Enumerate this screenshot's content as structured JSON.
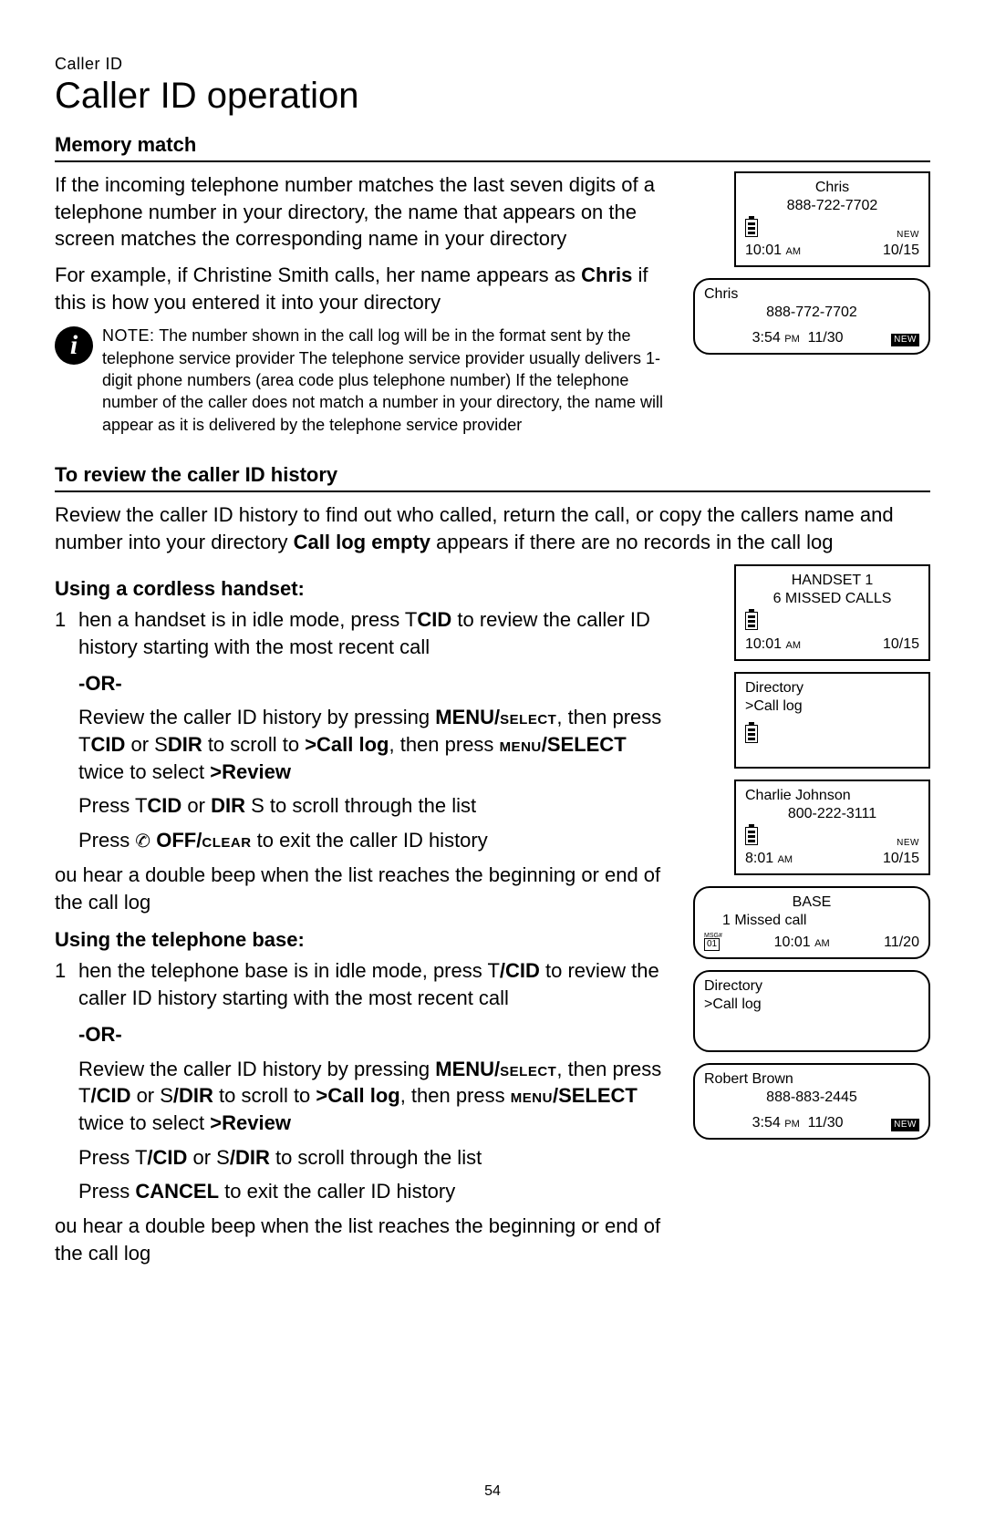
{
  "page": {
    "eyebrow": "Caller ID",
    "title": "Caller ID operation",
    "pagenum": "54"
  },
  "memory_match": {
    "heading": "Memory match",
    "p1": "If the incoming telephone number matches the last seven digits of a telephone number in your directory, the name that appears on the screen matches the corresponding name in your directory",
    "p2_pre": "For example, if Christine Smith calls, her name appears as ",
    "p2_bold": "Chris",
    "p2_post": " if this is how you entered it into your directory"
  },
  "note": {
    "label": "NOTE:",
    "text": "The number shown in the call log will be in the format sent by the telephone service provider The telephone service provider usually delivers 1-digit phone numbers (area code plus telephone number) If the telephone number of the caller does not match a number in your directory, the name will appear as it is delivered by the telephone service provider"
  },
  "review": {
    "heading": "To review the caller ID history",
    "intro_pre": "Review the caller ID history to find out who called, return the call, or copy the callers name and number into your directory ",
    "intro_bold": "Call log empty",
    "intro_post": " appears if there are no records in the call log"
  },
  "handset": {
    "heading": "Using a cordless handset:",
    "step1_num": "1",
    "step1_pre": "hen a handset is in idle mode, press   T",
    "step1_b1": "CID",
    "step1_post": " to review the caller ID history  starting with the most recent call",
    "or": "-OR-",
    "alt_l1_pre": "Review the caller ID history by pressing   ",
    "alt_l1_b": "MENU/",
    "alt_l1_sc": "select",
    "alt_l1_post": ", then press   T",
    "alt_l1_b2": "CID",
    "alt_l1_mid": " or   S",
    "alt_l1_b3": "DIR",
    "alt_l1_mid2": " to scroll to  ",
    "alt_l1_b4": ">Call log",
    "alt_l1_mid3": ", then press  ",
    "alt_l1_sc2": "menu",
    "alt_l1_b5": "/SELECT",
    "alt_l1_mid4": " twice to  select  ",
    "alt_l1_b6": ">Review",
    "scroll_pre": "Press   T",
    "scroll_b1": "CID",
    "scroll_mid": " or  ",
    "scroll_b2": "DIR",
    "scroll_post": " S  to scroll through the list",
    "exit_pre": "Press  ",
    "exit_b": "OFF/",
    "exit_sc": "clear",
    "exit_post": " to  exit the caller ID history",
    "beep": "ou hear a double beep when the list reaches the beginning or end of the call log"
  },
  "base": {
    "heading": "Using the telephone base:",
    "step1_num": "1",
    "step1_pre": "hen  the telephone base  is in idle mode, press   T",
    "step1_b1": "/CID",
    "step1_post": " to review the caller ID history starting with the most recent call",
    "or": "-OR-",
    "alt_l1_pre": "Review the caller ID history by pressing   ",
    "alt_l1_b": "MENU/",
    "alt_l1_sc": "select",
    "alt_l1_post": ", then press   T",
    "alt_l1_b2": "/CID",
    "alt_l1_mid": " or   S",
    "alt_l1_b3": "/DIR",
    "alt_l1_mid2": " to scroll to  ",
    "alt_l1_b4": ">Call log",
    "alt_l1_mid3": ", then press  ",
    "alt_l1_sc2": "menu",
    "alt_l1_b5": "/SELECT",
    "alt_l1_mid4": " twice to  select  ",
    "alt_l1_b6": ">Review",
    "scroll_pre": "Press   T",
    "scroll_b1": "/CID",
    "scroll_mid": " or   S",
    "scroll_b2": "/DIR",
    "scroll_post": " to scroll through the list",
    "exit_pre": "Press  ",
    "exit_b": "CANCEL",
    "exit_post": " to  exit the caller ID history",
    "beep": "ou hear a double beep when the list reaches the beginning or end of the call log"
  },
  "screens": {
    "s1": {
      "name": "Chris",
      "number": "888-722-7702",
      "time": "10:01",
      "ampm": "AM",
      "date": "10/15",
      "new": "NEW"
    },
    "s2": {
      "name": "Chris",
      "number": "888-772-7702",
      "time": "3:54",
      "ampm": "PM",
      "date": "11/30",
      "new": "NEW"
    },
    "s3": {
      "line1": "HANDSET 1",
      "line2": "6 MISSED CALLS",
      "time": "10:01",
      "ampm": "AM",
      "date": "10/15"
    },
    "s4": {
      "line1": "Directory",
      "line2": ">Call log"
    },
    "s5": {
      "name": "Charlie Johnson",
      "number": "800-222-3111",
      "time": "8:01",
      "ampm": "AM",
      "date": "10/15",
      "new": "NEW"
    },
    "s6": {
      "line1": "BASE",
      "line2": "1 Missed call",
      "msg": "01",
      "time": "10:01",
      "ampm": "AM",
      "date": "11/20"
    },
    "s7": {
      "line1": "Directory",
      "line2": ">Call log"
    },
    "s8": {
      "name": "Robert Brown",
      "number": "888-883-2445",
      "time": "3:54",
      "ampm": "PM",
      "date": "11/30",
      "new": "NEW"
    }
  }
}
